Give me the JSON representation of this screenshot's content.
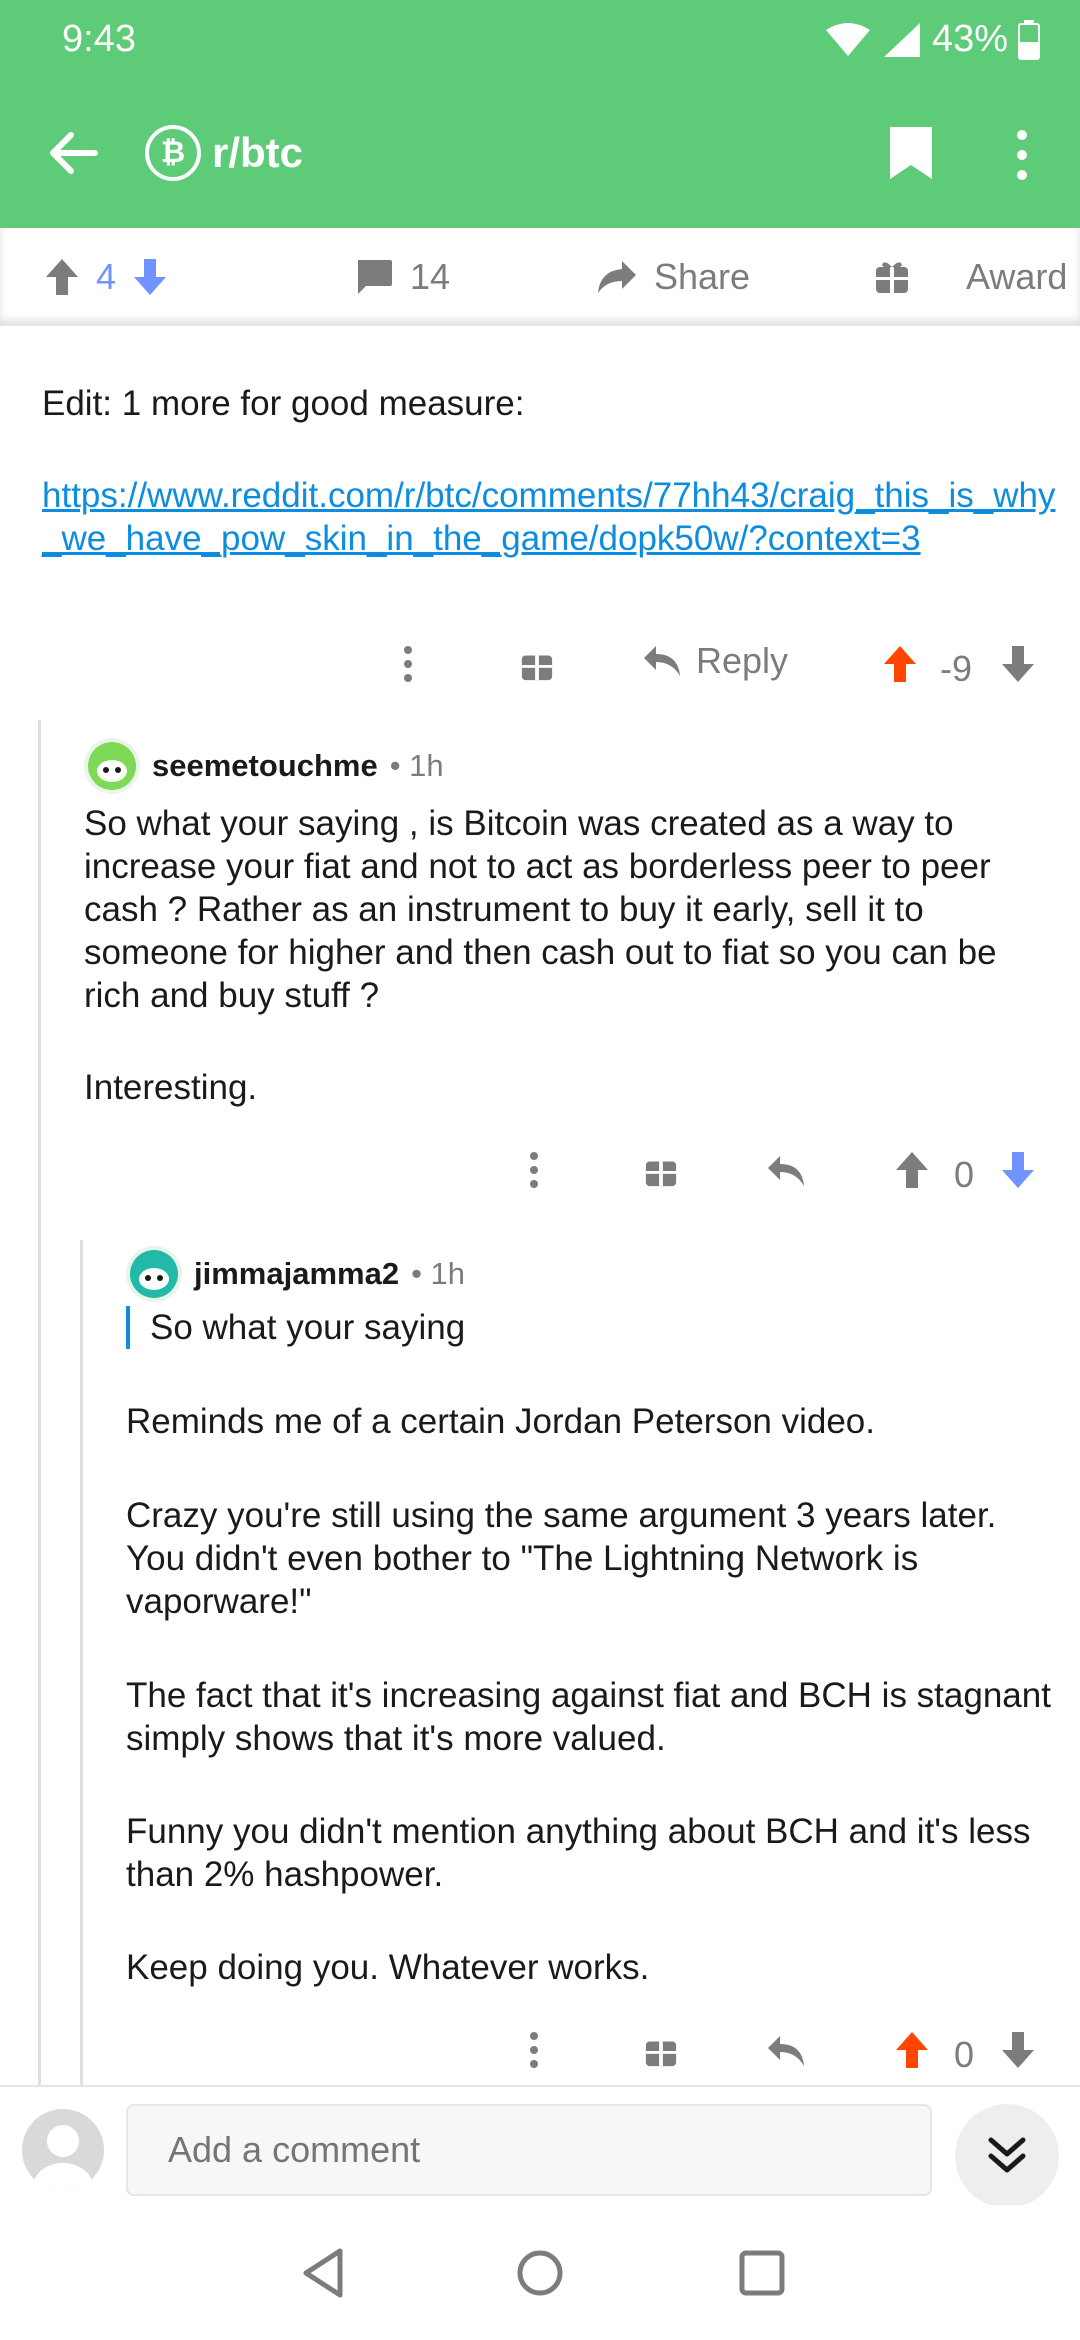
{
  "status": {
    "time": "9:43",
    "battery": "43%"
  },
  "appbar": {
    "subreddit": "r/btc",
    "sub_icon": "₿"
  },
  "actionbar": {
    "votes": "4",
    "comments": "14",
    "share": "Share",
    "award": "Award"
  },
  "post": {
    "edit_text": "Edit: 1 more for good measure:",
    "link": "https://www.reddit.com/r/btc/comments/77hh43/craig_this_is_why_we_have_pow_skin_in_the_game/dopk50w/?context=3",
    "reply_label": "Reply",
    "score": "-9"
  },
  "comment1": {
    "author": "seemetouchme",
    "meta": "• 1h",
    "body": "So what your saying , is Bitcoin was created as a way to increase your fiat and not to act as borderless peer to peer cash ?  Rather as an instrument to buy it early, sell it to someone for higher and then cash out to fiat so you can be rich and buy stuff ?",
    "body2": "Interesting.",
    "score": "0"
  },
  "comment2": {
    "author": "jimmajamma2",
    "meta": "• 1h",
    "quote": "So what your saying",
    "p1": "Reminds me of a certain Jordan Peterson video.",
    "p2": "Crazy you're still using the same argument 3 years later. You didn't even bother to \"The Lightning Network is vaporware!\"",
    "p3": "The fact that it's increasing against fiat and BCH is stagnant simply shows that it's more valued.",
    "p4": "Funny you didn't mention anything about BCH and it's less than 2% hashpower.",
    "p5": "Keep doing you. Whatever works.",
    "score": "0"
  },
  "bottombar": {
    "placeholder": "Add a comment"
  },
  "colors": {
    "header": "#5ecb78",
    "upvote": "#ff4500",
    "downvote": "#7193ff",
    "link": "#0d8de0"
  }
}
